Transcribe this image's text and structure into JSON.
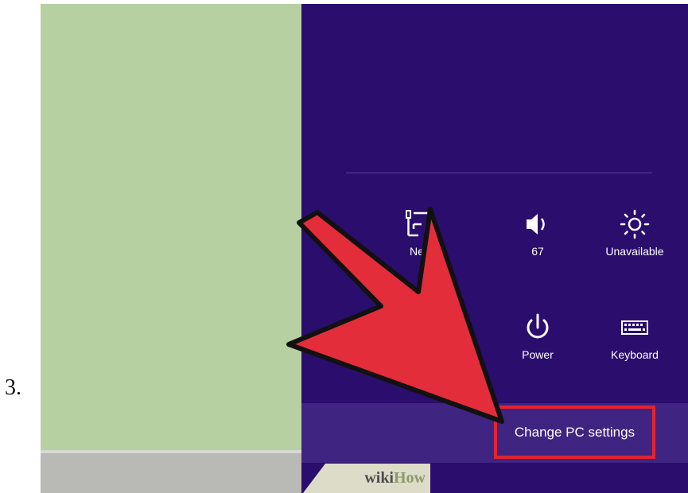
{
  "step": {
    "number": "3."
  },
  "charms": {
    "tiles": [
      {
        "label": "Ne",
        "icon": "network-icon"
      },
      {
        "label": "67",
        "icon": "volume-icon"
      },
      {
        "label": "Unavailable",
        "icon": "brightness-icon"
      },
      {
        "label": "Power",
        "icon": "power-icon"
      },
      {
        "label": "Keyboard",
        "icon": "keyboard-icon"
      }
    ],
    "change_pc_settings": "Change PC settings"
  },
  "watermark": {
    "part1": "wiki",
    "part2": "How"
  },
  "colors": {
    "desktop": "#b7d0a2",
    "panel": "#2b0d6e",
    "bottom_bar": "#3f2482",
    "highlight": "#e4232f",
    "arrow": "#e32d3a"
  }
}
